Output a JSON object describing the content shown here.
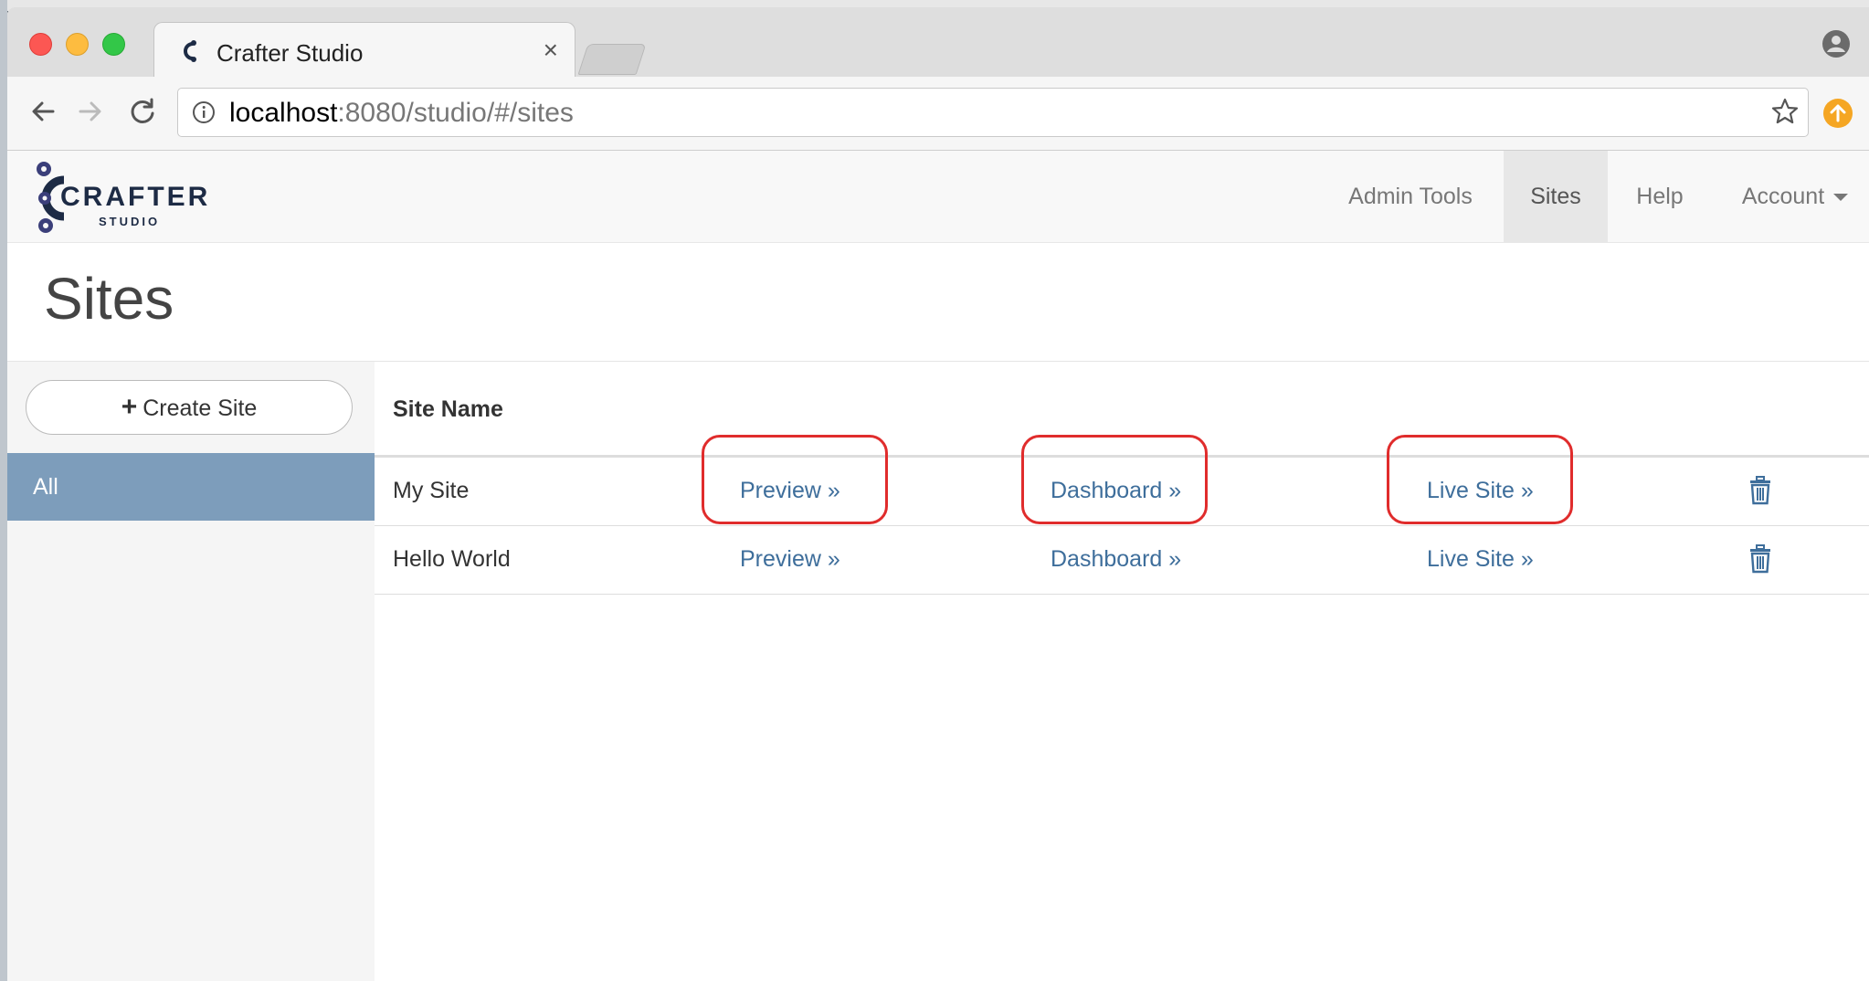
{
  "browser": {
    "tab_title": "Crafter Studio",
    "tab_close": "×",
    "url_host": "localhost",
    "url_rest": ":8080/studio/#/sites"
  },
  "navbar": {
    "logo_word": "CRAFTER",
    "logo_sub": "STUDIO",
    "items": [
      {
        "label": "Admin Tools"
      },
      {
        "label": "Sites",
        "active": true
      },
      {
        "label": "Help"
      },
      {
        "label": "Account"
      }
    ]
  },
  "page": {
    "title": "Sites"
  },
  "sidebar": {
    "create_label": "Create Site",
    "filter_all": "All"
  },
  "table": {
    "header": "Site Name",
    "rows": [
      {
        "name": "My Site",
        "preview": "Preview »",
        "dashboard": "Dashboard »",
        "live": "Live Site »"
      },
      {
        "name": "Hello World",
        "preview": "Preview »",
        "dashboard": "Dashboard »",
        "live": "Live Site »"
      }
    ]
  },
  "colors": {
    "accent_link": "#3e6e9b",
    "sidebar_active": "#7d9dbb",
    "highlight": "#e02c2c"
  }
}
